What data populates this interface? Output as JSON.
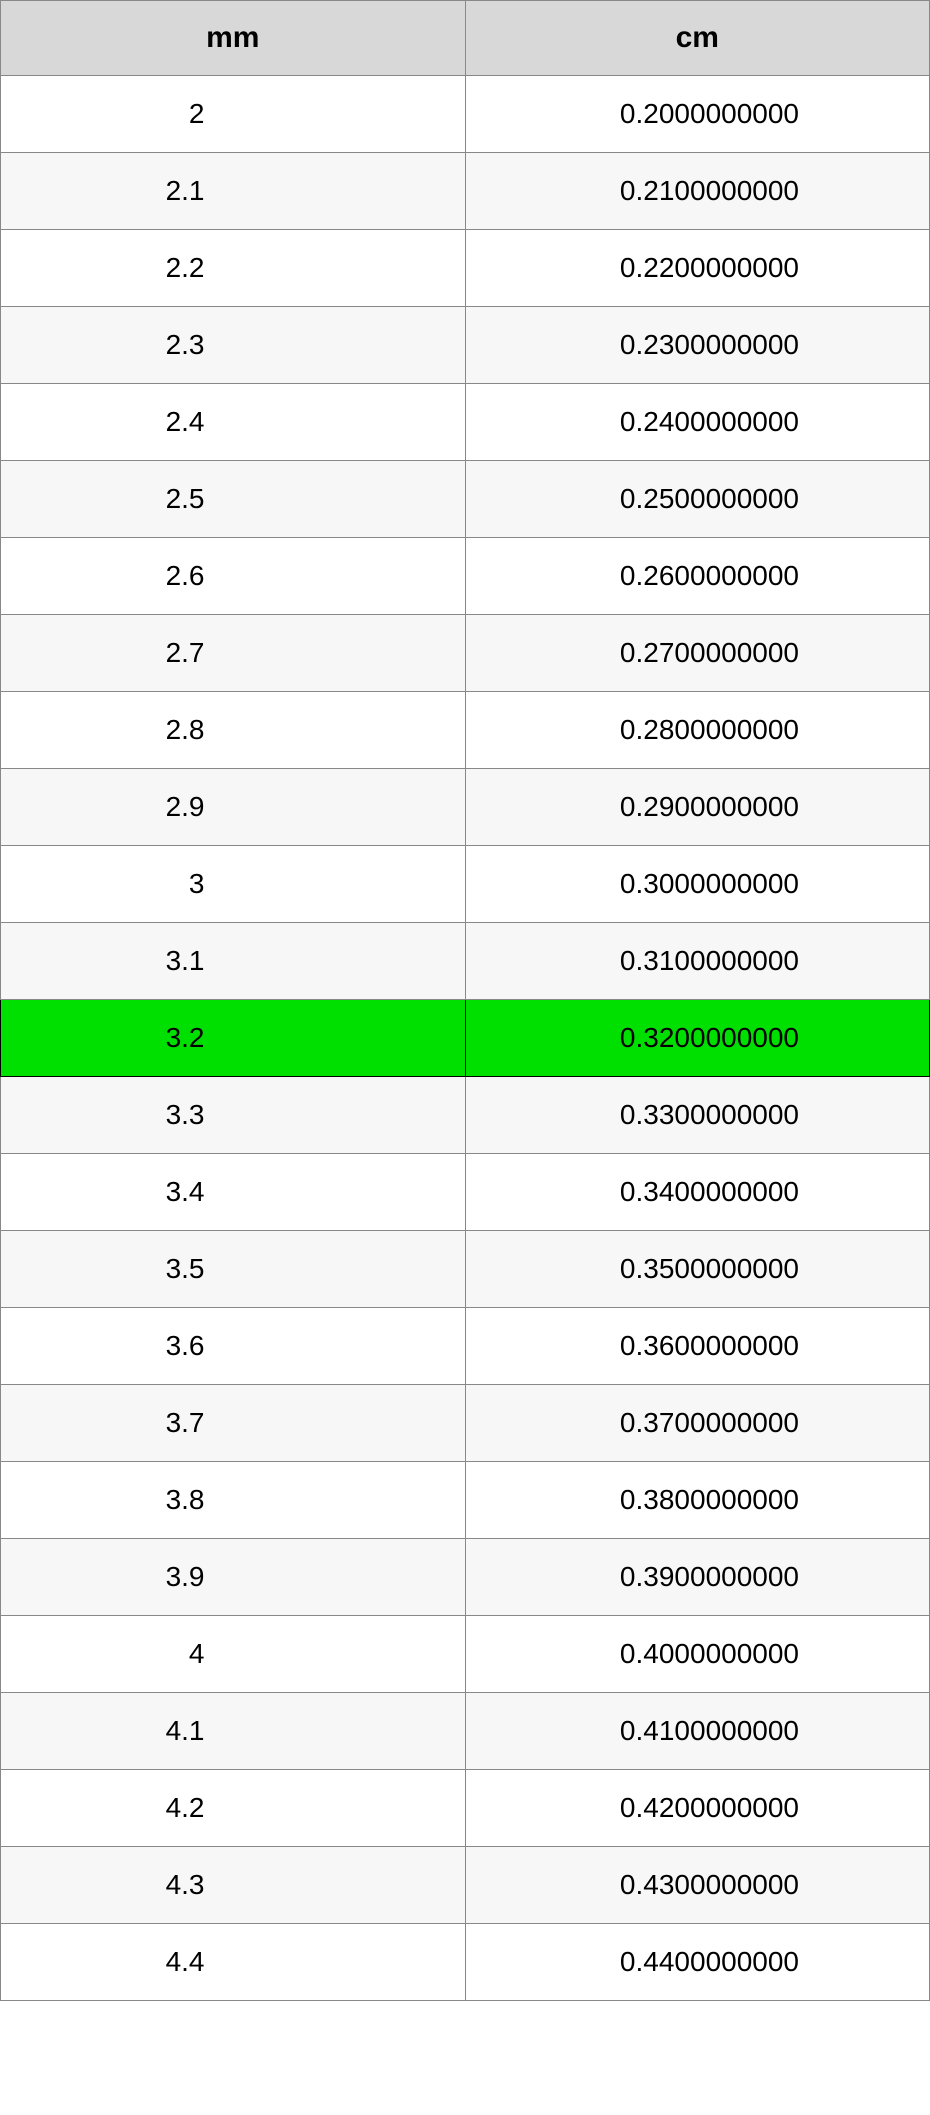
{
  "table": {
    "headers": {
      "mm": "mm",
      "cm": "cm"
    },
    "rows": [
      {
        "mm": "2",
        "cm": "0.2000000000",
        "highlight": false
      },
      {
        "mm": "2.1",
        "cm": "0.2100000000",
        "highlight": false
      },
      {
        "mm": "2.2",
        "cm": "0.2200000000",
        "highlight": false
      },
      {
        "mm": "2.3",
        "cm": "0.2300000000",
        "highlight": false
      },
      {
        "mm": "2.4",
        "cm": "0.2400000000",
        "highlight": false
      },
      {
        "mm": "2.5",
        "cm": "0.2500000000",
        "highlight": false
      },
      {
        "mm": "2.6",
        "cm": "0.2600000000",
        "highlight": false
      },
      {
        "mm": "2.7",
        "cm": "0.2700000000",
        "highlight": false
      },
      {
        "mm": "2.8",
        "cm": "0.2800000000",
        "highlight": false
      },
      {
        "mm": "2.9",
        "cm": "0.2900000000",
        "highlight": false
      },
      {
        "mm": "3",
        "cm": "0.3000000000",
        "highlight": false
      },
      {
        "mm": "3.1",
        "cm": "0.3100000000",
        "highlight": false
      },
      {
        "mm": "3.2",
        "cm": "0.3200000000",
        "highlight": true
      },
      {
        "mm": "3.3",
        "cm": "0.3300000000",
        "highlight": false
      },
      {
        "mm": "3.4",
        "cm": "0.3400000000",
        "highlight": false
      },
      {
        "mm": "3.5",
        "cm": "0.3500000000",
        "highlight": false
      },
      {
        "mm": "3.6",
        "cm": "0.3600000000",
        "highlight": false
      },
      {
        "mm": "3.7",
        "cm": "0.3700000000",
        "highlight": false
      },
      {
        "mm": "3.8",
        "cm": "0.3800000000",
        "highlight": false
      },
      {
        "mm": "3.9",
        "cm": "0.3900000000",
        "highlight": false
      },
      {
        "mm": "4",
        "cm": "0.4000000000",
        "highlight": false
      },
      {
        "mm": "4.1",
        "cm": "0.4100000000",
        "highlight": false
      },
      {
        "mm": "4.2",
        "cm": "0.4200000000",
        "highlight": false
      },
      {
        "mm": "4.3",
        "cm": "0.4300000000",
        "highlight": false
      },
      {
        "mm": "4.4",
        "cm": "0.4400000000",
        "highlight": false
      }
    ]
  },
  "colors": {
    "header_bg": "#d8d8d8",
    "row_alt_bg": "#f7f7f7",
    "highlight_bg": "#00e000",
    "border": "#888888"
  }
}
